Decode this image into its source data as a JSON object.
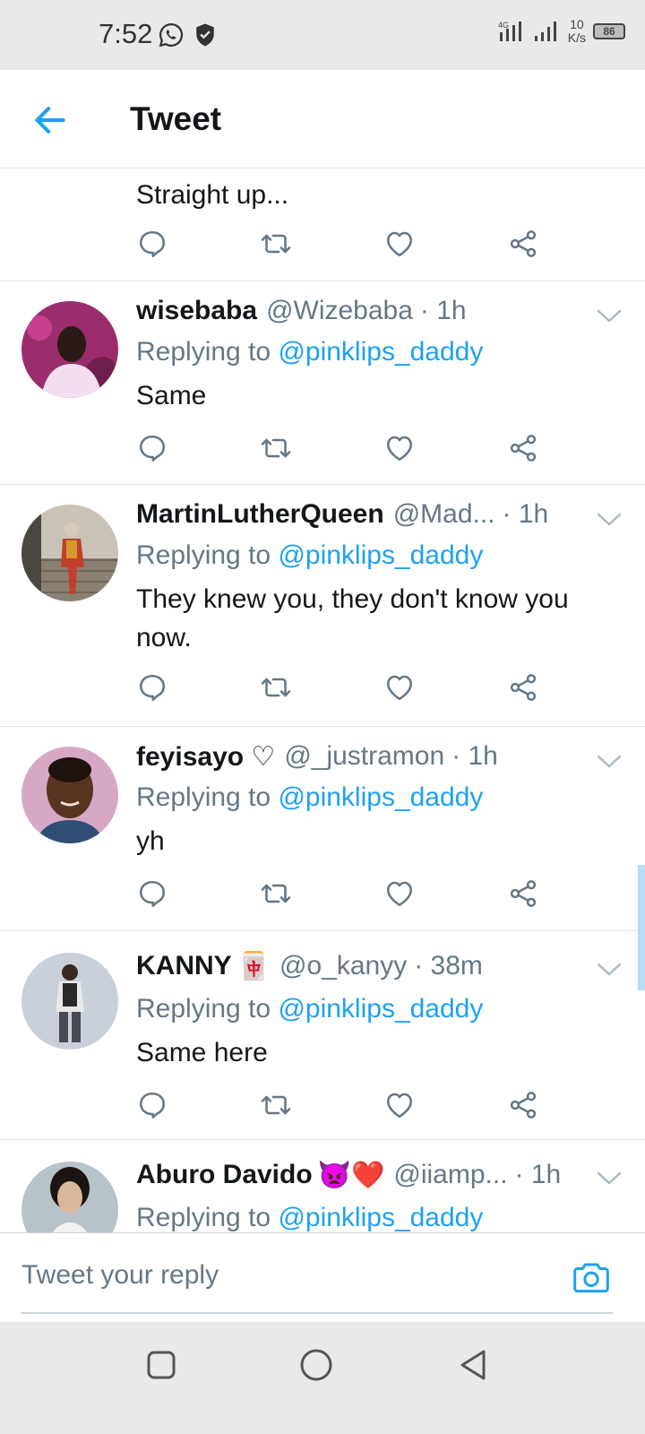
{
  "status_bar": {
    "time": "7:52",
    "net_speed_value": "10",
    "net_speed_unit": "K/s",
    "battery": "86",
    "network_label": "4G"
  },
  "header": {
    "title": "Tweet"
  },
  "top_tweet": {
    "text": "Straight up..."
  },
  "tweets": [
    {
      "name": "wisebaba",
      "handle": "@Wizebaba",
      "time": "· 1h",
      "replying_prefix": "Replying to",
      "replying_to": "@pinklips_daddy",
      "text": "Same"
    },
    {
      "name": "MartinLutherQueen",
      "handle": "@Mad...",
      "time": "· 1h",
      "replying_prefix": "Replying to",
      "replying_to": "@pinklips_daddy",
      "text": "They knew you, they don't know you now."
    },
    {
      "name": "feyisayo ♡",
      "handle": "@_justramon",
      "time": "· 1h",
      "replying_prefix": "Replying to",
      "replying_to": "@pinklips_daddy",
      "text": "yh"
    },
    {
      "name": "KANNY",
      "emoji": "🀄",
      "handle": "@o_kanyy",
      "time": "· 38m",
      "replying_prefix": "Replying to",
      "replying_to": "@pinklips_daddy",
      "text": "Same here"
    },
    {
      "name": "Aburo Davido",
      "emoji": "👿❤️",
      "handle": "@iiamp...",
      "time": "· 1h",
      "replying_prefix": "Replying to",
      "replying_to": "@pinklips_daddy",
      "text": ""
    }
  ],
  "reply_bar": {
    "placeholder": "Tweet your reply"
  },
  "colors": {
    "accent": "#1da1f2",
    "muted": "#657786",
    "text": "#14171a",
    "divider": "#e1e8ed"
  },
  "icons": [
    "back-arrow-icon",
    "reply-icon",
    "retweet-icon",
    "like-icon",
    "share-icon",
    "caret-down-icon",
    "camera-icon",
    "recent-apps-icon",
    "home-icon",
    "back-icon"
  ]
}
